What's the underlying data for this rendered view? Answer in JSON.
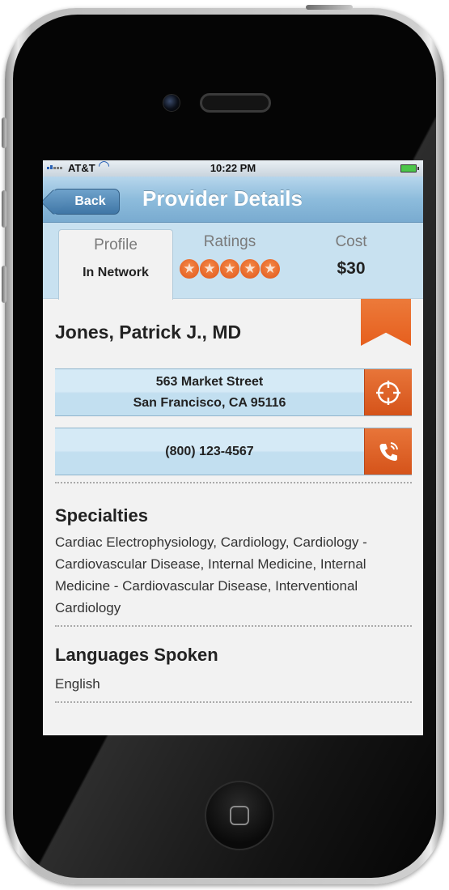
{
  "status_bar": {
    "carrier": "AT&T",
    "time": "10:22 PM"
  },
  "nav": {
    "back_label": "Back",
    "title": "Provider Details"
  },
  "tabs": [
    {
      "label": "Profile",
      "value": "In Network",
      "active": true
    },
    {
      "label": "Ratings",
      "value": "",
      "stars": 5,
      "stars_max": 5
    },
    {
      "label": "Cost",
      "value": "$30"
    }
  ],
  "provider": {
    "name": "Jones, Patrick J., MD",
    "address_line1": "563 Market Street",
    "address_line2": "San Francisco, CA 95116",
    "phone": "(800) 123-4567"
  },
  "sections": {
    "specialties_title": "Specialties",
    "specialties_text": "Cardiac Electrophysiology, Cardiology, Cardiology - Cardiovascular Disease, Internal Medicine, Internal Medicine - Cardiovascular Disease, Interventional Cardiology",
    "languages_title": "Languages Spoken",
    "languages_text": "English"
  },
  "icons": {
    "bookmark": "bookmark-icon",
    "location": "crosshair-icon",
    "phone": "phone-icon",
    "star": "star-icon"
  },
  "colors": {
    "accent_orange": "#e65f1e",
    "nav_blue": "#8dbcdc",
    "tab_bg": "#c8e1f0"
  }
}
